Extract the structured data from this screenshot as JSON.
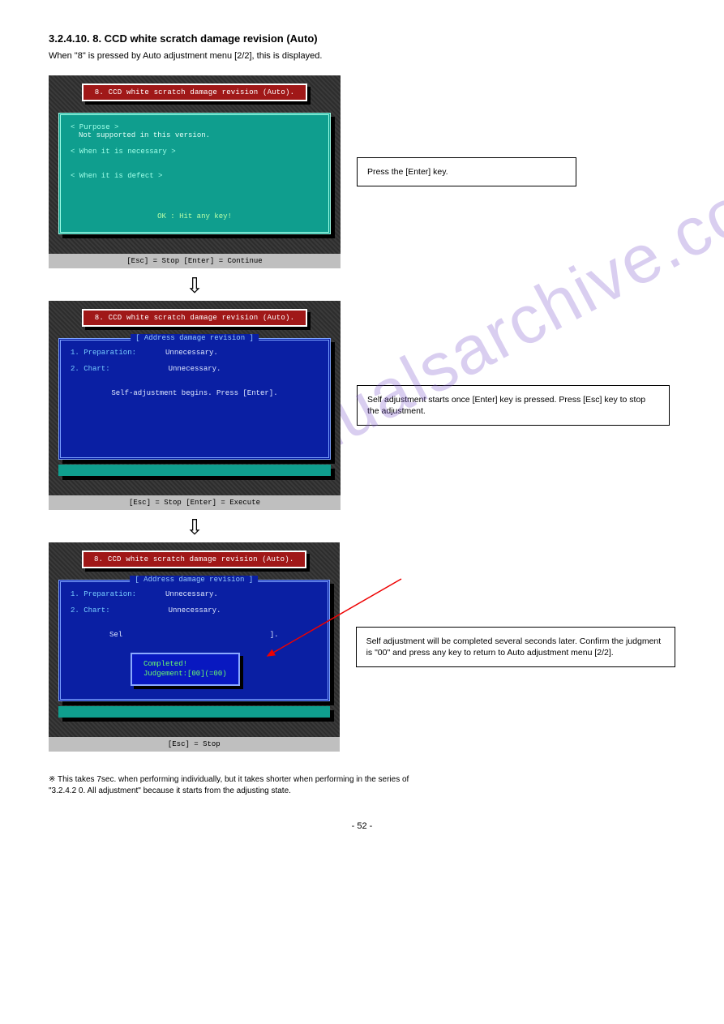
{
  "header": {
    "title": "3.2.4.10.   8. CCD white scratch damage revision (Auto)",
    "sub": "When \"8\" is pressed by Auto adjustment menu [2/2], this is displayed."
  },
  "screen1": {
    "title": "8. CCD white scratch damage revision (Auto).",
    "purpose_label": "< Purpose >",
    "purpose_body": "Not supported in this version.",
    "necessary_label": "< When it is necessary >",
    "defect_label": "< When it is defect >",
    "ok_hint": "OK : Hit any key!",
    "footer": "[Esc] = Stop   [Enter] = Continue"
  },
  "callout1": "Press the [Enter] key.",
  "screen2": {
    "title": "8. CCD white scratch damage revision (Auto).",
    "inner_title": "[ Address damage revision ]",
    "line1a": "1. Preparation:",
    "line1b": "Unnecessary.",
    "line2a": "2. Chart:",
    "line2b": "Unnecessary.",
    "hint": "Self-adjustment begins. Press [Enter].",
    "footer": "[Esc] = Stop   [Enter] = Execute"
  },
  "callout2": "Self adjustment starts once [Enter] key is pressed. Press [Esc] key to stop the adjustment.",
  "screen3": {
    "title": "8. CCD white scratch damage revision (Auto).",
    "inner_title": "[ Address damage revision ]",
    "line1a": "1. Preparation:",
    "line1b": "Unnecessary.",
    "line2a": "2. Chart:",
    "line2b": "Unnecessary.",
    "bg_hint_l": "Sel",
    "bg_hint_r": "].",
    "popup_l1": "Completed!",
    "popup_l2": "Judgement:[00](=00)",
    "footer": "[Esc] = Stop"
  },
  "callout3": "Self adjustment will be completed several seconds later. Confirm the judgment is \"00\" and press any key to return to Auto adjustment menu [2/2].",
  "closing_note": "※ This takes 7sec. when performing individually, but it takes shorter when performing in the series of\n     \"3.2.4.2   0. All adjustment\" because it starts from the adjusting state.",
  "page_number": "- 52 -",
  "watermark": "manualsarchive.com"
}
